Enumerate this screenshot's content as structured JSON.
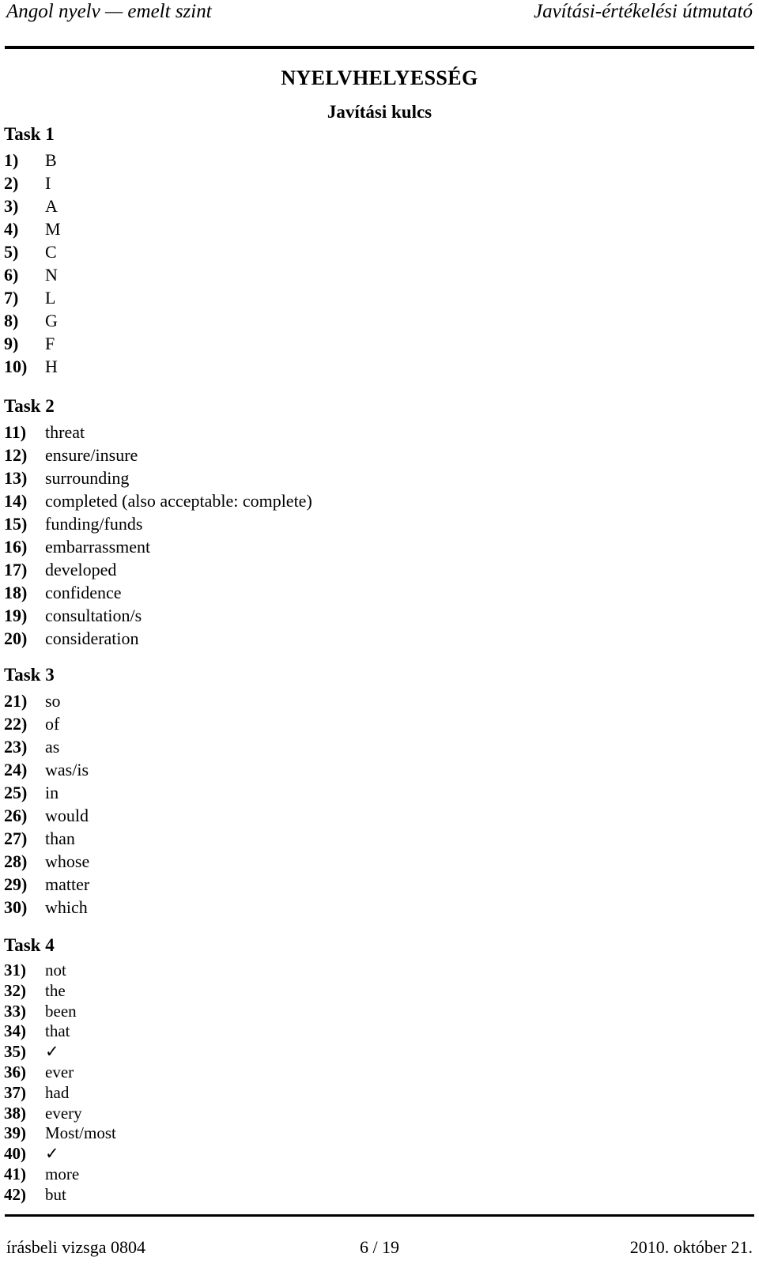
{
  "header": {
    "left": "Angol nyelv — emelt szint",
    "right": "Javítási-értékelési útmutató"
  },
  "title": "NYELVHELYESSÉG",
  "subtitle": "Javítási kulcs",
  "tasks": [
    {
      "heading": "Task 1",
      "items": [
        {
          "num": "1)",
          "answer": "B"
        },
        {
          "num": "2)",
          "answer": "I"
        },
        {
          "num": "3)",
          "answer": "A"
        },
        {
          "num": "4)",
          "answer": "M"
        },
        {
          "num": "5)",
          "answer": "C"
        },
        {
          "num": "6)",
          "answer": "N"
        },
        {
          "num": "7)",
          "answer": "L"
        },
        {
          "num": "8)",
          "answer": "G"
        },
        {
          "num": "9)",
          "answer": "F"
        },
        {
          "num": "10)",
          "answer": "H"
        }
      ]
    },
    {
      "heading": "Task 2",
      "items": [
        {
          "num": "11)",
          "answer": "threat"
        },
        {
          "num": "12)",
          "answer": "ensure/insure"
        },
        {
          "num": "13)",
          "answer": "surrounding"
        },
        {
          "num": "14)",
          "answer": "completed (also acceptable: complete)"
        },
        {
          "num": "15)",
          "answer": "funding/funds"
        },
        {
          "num": "16)",
          "answer": "embarrassment"
        },
        {
          "num": "17)",
          "answer": "developed"
        },
        {
          "num": "18)",
          "answer": "confidence"
        },
        {
          "num": "19)",
          "answer": "consultation/s"
        },
        {
          "num": "20)",
          "answer": "consideration"
        }
      ]
    },
    {
      "heading": "Task 3",
      "items": [
        {
          "num": "21)",
          "answer": "so"
        },
        {
          "num": "22)",
          "answer": "of"
        },
        {
          "num": "23)",
          "answer": "as"
        },
        {
          "num": "24)",
          "answer": "was/is"
        },
        {
          "num": "25)",
          "answer": "in"
        },
        {
          "num": "26)",
          "answer": "would"
        },
        {
          "num": "27)",
          "answer": "than"
        },
        {
          "num": "28)",
          "answer": "whose"
        },
        {
          "num": "29)",
          "answer": "matter"
        },
        {
          "num": "30)",
          "answer": "which"
        }
      ]
    },
    {
      "heading": "Task 4",
      "items": [
        {
          "num": "31)",
          "answer": "not"
        },
        {
          "num": "32)",
          "answer": "the"
        },
        {
          "num": "33)",
          "answer": "been"
        },
        {
          "num": "34)",
          "answer": "that"
        },
        {
          "num": "35)",
          "answer": "✓"
        },
        {
          "num": "36)",
          "answer": "ever"
        },
        {
          "num": "37)",
          "answer": "had"
        },
        {
          "num": "38)",
          "answer": "every"
        },
        {
          "num": "39)",
          "answer": "Most/most"
        },
        {
          "num": "40)",
          "answer": "✓"
        },
        {
          "num": "41)",
          "answer": "more"
        },
        {
          "num": "42)",
          "answer": "but"
        }
      ]
    }
  ],
  "footer": {
    "left": "írásbeli vizsga 0804",
    "center": "6 / 19",
    "right": "2010. október 21."
  }
}
